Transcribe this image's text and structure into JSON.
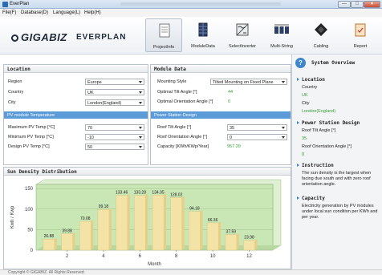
{
  "window": {
    "title": "EverPlan",
    "min_label": "—",
    "max_label": "□",
    "close_label": "✕"
  },
  "menu": [
    "File(F)",
    "Database(D)",
    "Language(L)",
    "Help(H)"
  ],
  "header": {
    "logo": "GIGABIZ",
    "product": "EVERPLAN"
  },
  "toolbar": [
    {
      "label": "ProjectInfo",
      "icon": "document-icon",
      "active": true
    },
    {
      "label": "ModuleData",
      "icon": "solar-panel-icon",
      "active": false
    },
    {
      "label": "SelectInverter",
      "icon": "inverter-icon",
      "active": false
    },
    {
      "label": "Multi-String",
      "icon": "multi-string-icon",
      "active": false
    },
    {
      "label": "Cabling",
      "icon": "cabling-icon",
      "active": false
    },
    {
      "label": "Report",
      "icon": "report-icon",
      "active": false
    }
  ],
  "location": {
    "title": "Location",
    "region_label": "Region",
    "region_value": "Europe",
    "country_label": "Country",
    "country_value": "UK",
    "city_label": "City",
    "city_value": "London(England)",
    "pv_temp_title": "PV module Temperature",
    "max_label": "Maximum PV Temp [°C]",
    "max_value": "70",
    "min_label": "Minimum PV Temp [°C]",
    "min_value": "-10",
    "design_label": "Design  PV Temp [°C]",
    "design_value": "50"
  },
  "module": {
    "title": "Module Data",
    "mounting_label": "Mounting Style",
    "mounting_value": "Tilted Mounting on Fixed Plane",
    "opt_tilt_label": "Optimal Tilt Angle [°]",
    "opt_tilt_value": "44",
    "opt_orient_label": "Optimal Orientation Angle [°]",
    "opt_orient_value": "0",
    "station_title": "Power Station Design",
    "roof_tilt_label": "Roof Tilt Angle [°]",
    "roof_tilt_value": "35",
    "roof_orient_label": "Roof Orientation Angle [°]",
    "roof_orient_value": "0",
    "capacity_label": "Capacity [KWh/KWp/Year]",
    "capacity_value": "957.29"
  },
  "overview": {
    "title": "System Overview",
    "location_title": "Location",
    "country_label": "Country",
    "country_value": "UK",
    "city_label": "City",
    "city_value": "London(England)",
    "station_title": "Power Station Design",
    "roof_tilt_label": "Roof Tilt Angle [°]",
    "roof_tilt_value": "35",
    "roof_orient_label": "Roof Orientation Angle [°]",
    "roof_orient_value": "0",
    "instruction_title": "Instruction",
    "instruction_text": "The sun density is the largest when facing due south and with zero roof orientation angle.",
    "capacity_title": "Capacity",
    "capacity_text": "Electricity generation by PV modules under local sun condition per KWh and per year."
  },
  "status": {
    "copyright": "Copyright © GIGABIZ. All Rights Reserved."
  },
  "colors": {
    "bar": "#f3e3a6",
    "plot_bg": "#c9e6b5",
    "accent": "#5a9bd8"
  },
  "chart_data": {
    "type": "bar",
    "title": "Sun Density Distribution",
    "x": [
      1,
      2,
      3,
      4,
      5,
      6,
      7,
      8,
      9,
      10,
      11,
      12
    ],
    "values": [
      26.88,
      39.88,
      70.08,
      99.18,
      133.46,
      133.28,
      134.05,
      128.02,
      94.18,
      66.36,
      37.59,
      23.98
    ],
    "labels": [
      "26.88",
      "39.88",
      "70.08",
      "99.18",
      "133.46",
      "133.28",
      "134.05",
      "128.02",
      "94.18",
      "66.36",
      "37.59",
      "23.98"
    ],
    "xlabel": "Month",
    "ylabel": "Kwh / Kwp",
    "x_ticks": [
      "2",
      "4",
      "6",
      "8",
      "10",
      "12"
    ],
    "y_ticks": [
      "0",
      "50",
      "100",
      "150"
    ],
    "ylim": [
      0,
      160
    ],
    "grid": true
  }
}
